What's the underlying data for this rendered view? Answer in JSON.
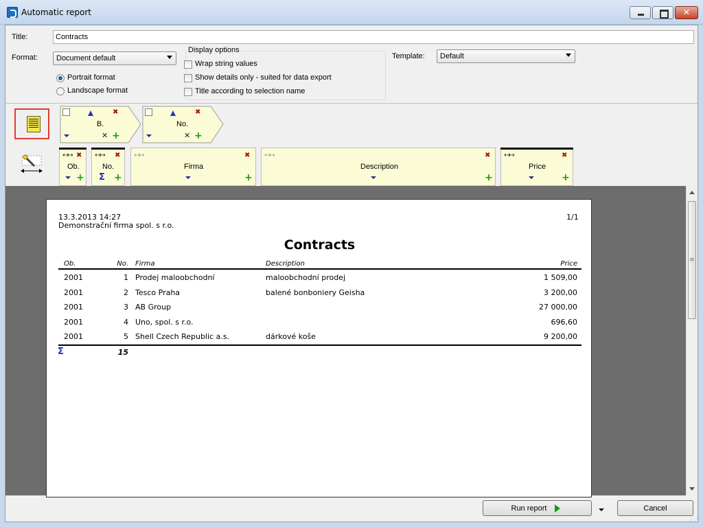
{
  "window": {
    "title": "Automatic report"
  },
  "form": {
    "title_label": "Title:",
    "title_value": "Contracts",
    "format_label": "Format:",
    "format_value": "Document default",
    "portrait_label": "Portrait format",
    "landscape_label": "Landscape format",
    "orientation_selected": "Portrait format",
    "display_options_label": "Display options",
    "wrap_label": "Wrap string values",
    "details_label": "Show details only - suited for data export",
    "title_sel_label": "Title according to selection name",
    "template_label": "Template:",
    "template_value": "Default"
  },
  "groups": [
    {
      "label": "B.",
      "sort": "ascending"
    },
    {
      "label": "No.",
      "sort": "ascending"
    }
  ],
  "columns": [
    {
      "label": "Ob."
    },
    {
      "label": "No.",
      "sum": "Σ"
    },
    {
      "label": "Firma"
    },
    {
      "label": "Description"
    },
    {
      "label": "Price"
    }
  ],
  "report": {
    "datetime": "13.3.2013 14:27",
    "company": "Demonstrační firma spol. s r.o.",
    "page": "1/1",
    "title": "Contracts",
    "headers": [
      "Ob.",
      "No.",
      "Firma",
      "Description",
      "Price"
    ],
    "rows": [
      [
        "2001",
        "1",
        "Prodej maloobchodní",
        "maloobchodní prodej",
        "1 509,00"
      ],
      [
        "2001",
        "2",
        "Tesco Praha",
        "balené bonboniery Geisha",
        "3 200,00"
      ],
      [
        "2001",
        "3",
        "AB Group",
        "",
        "27 000,00"
      ],
      [
        "2001",
        "4",
        "Uno, spol. s r.o.",
        "",
        "696,60"
      ],
      [
        "2001",
        "5",
        "Shell Czech Republic a.s.",
        "dárkové koše",
        "9 200,00"
      ]
    ],
    "sum_symbol": "Σ",
    "sum_no": "15"
  },
  "buttons": {
    "run": "Run report",
    "cancel": "Cancel"
  },
  "colors": {
    "note_yellow": "#fbfbd6",
    "accent_blue": "#1d2ec4",
    "remove_red": "#b10e0e",
    "add_green": "#159d15"
  }
}
